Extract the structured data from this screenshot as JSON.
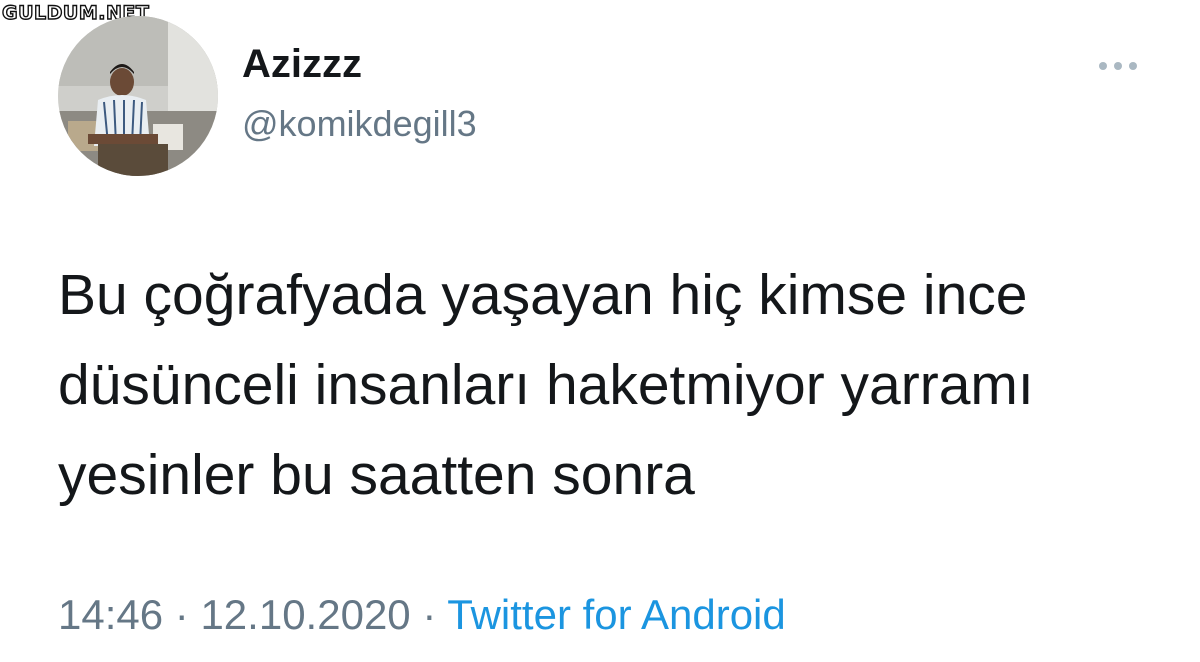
{
  "watermark": {
    "text": "GULDUM.NET"
  },
  "author": {
    "display_name": "Azizzz",
    "handle": "@komikdegill3"
  },
  "tweet": {
    "lines": [
      "Bu çoğrafyada yaşayan hiç kimse ince",
      "düsünceli insanları haketmiyor yarramı",
      "yesinler bu saatten sonra"
    ]
  },
  "meta": {
    "time": "14:46",
    "separator": "·",
    "date": "12.10.2020",
    "source": "Twitter for Android"
  },
  "icons": {
    "more": "more-horizontal-icon",
    "avatar": "profile-photo"
  },
  "colors": {
    "text_primary": "#14171a",
    "text_secondary": "#657786",
    "link": "#1b95e0"
  }
}
